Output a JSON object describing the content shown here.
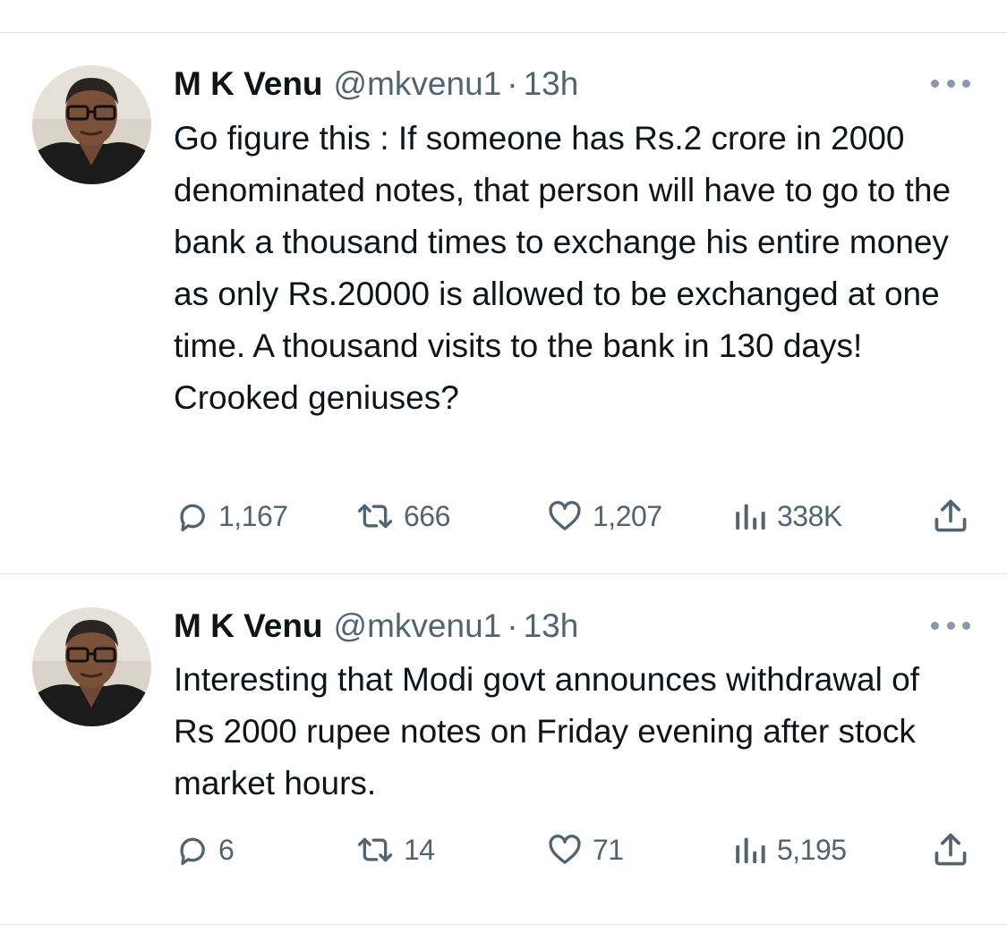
{
  "tweets": [
    {
      "author_name": "M K Venu",
      "handle": "@mkvenu1",
      "separator": "·",
      "time": "13h",
      "text": "Go figure this : If someone  has Rs.2 crore in 2000 denominated notes, that person will have to go to the bank a thousand times to exchange his entire money as only Rs.20000 is allowed to be exchanged at one time. A thousand visits to the bank in 130 days! Crooked geniuses?",
      "replies": "1,167",
      "retweets": "666",
      "likes": "1,207",
      "views": "338K"
    },
    {
      "author_name": "M K Venu",
      "handle": "@mkvenu1",
      "separator": "·",
      "time": "13h",
      "text": "Interesting that Modi govt announces withdrawal of Rs 2000 rupee notes on Friday evening after stock market hours.",
      "replies": "6",
      "retweets": "14",
      "likes": "71",
      "views": "5,195"
    }
  ],
  "icons": {
    "reply": "reply-icon",
    "retweet": "retweet-icon",
    "like": "heart-icon",
    "views": "views-chart-icon",
    "share": "share-icon",
    "more": "more-dots-icon"
  },
  "colors": {
    "text_primary": "#0f1419",
    "text_secondary": "#536471",
    "divider": "#e1e5e8"
  }
}
